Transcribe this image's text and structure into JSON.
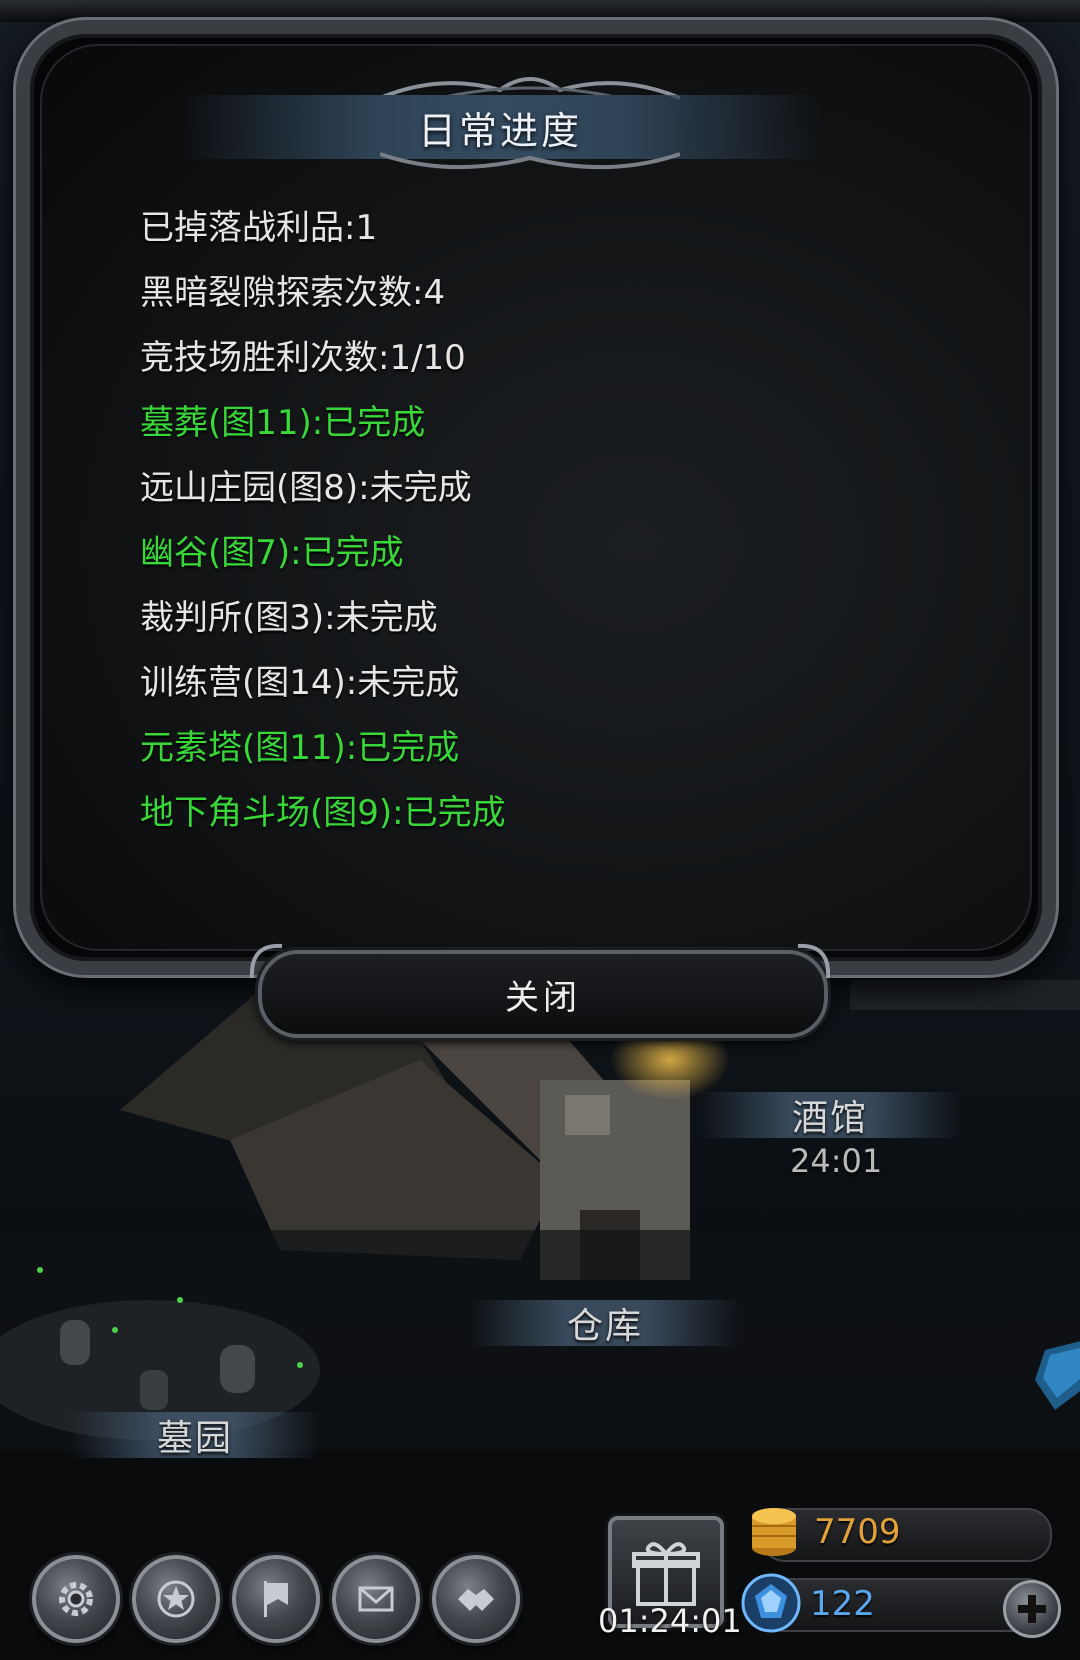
{
  "dialog": {
    "title": "日常进度",
    "items": [
      {
        "text": "已掉落战利品:1",
        "status": "todo"
      },
      {
        "text": "黑暗裂隙探索次数:4",
        "status": "todo"
      },
      {
        "text": "竞技场胜利次数:1/10",
        "status": "todo"
      },
      {
        "text": "墓葬(图11):已完成",
        "status": "done"
      },
      {
        "text": "远山庄园(图8):未完成",
        "status": "todo"
      },
      {
        "text": "幽谷(图7):已完成",
        "status": "done"
      },
      {
        "text": "裁判所(图3):未完成",
        "status": "todo"
      },
      {
        "text": "训练营(图14):未完成",
        "status": "todo"
      },
      {
        "text": "元素塔(图11):已完成",
        "status": "done"
      },
      {
        "text": "地下角斗场(图9):已完成",
        "status": "done"
      }
    ],
    "close_label": "关闭"
  },
  "scene": {
    "tavern_label": "酒馆",
    "tavern_timer": "24:01",
    "warehouse_label": "仓库",
    "cemetery_label": "墓园"
  },
  "hud": {
    "gift_timer": "01:24:01",
    "gold": "7709",
    "gems": "122",
    "buttons": [
      "settings-icon",
      "star-medal-icon",
      "banner-icon",
      "mail-icon",
      "handshake-icon"
    ],
    "colors": {
      "done": "#38d838",
      "todo": "#e6e6e6",
      "gold": "#e2a23a",
      "gem": "#5aa8f0"
    }
  }
}
